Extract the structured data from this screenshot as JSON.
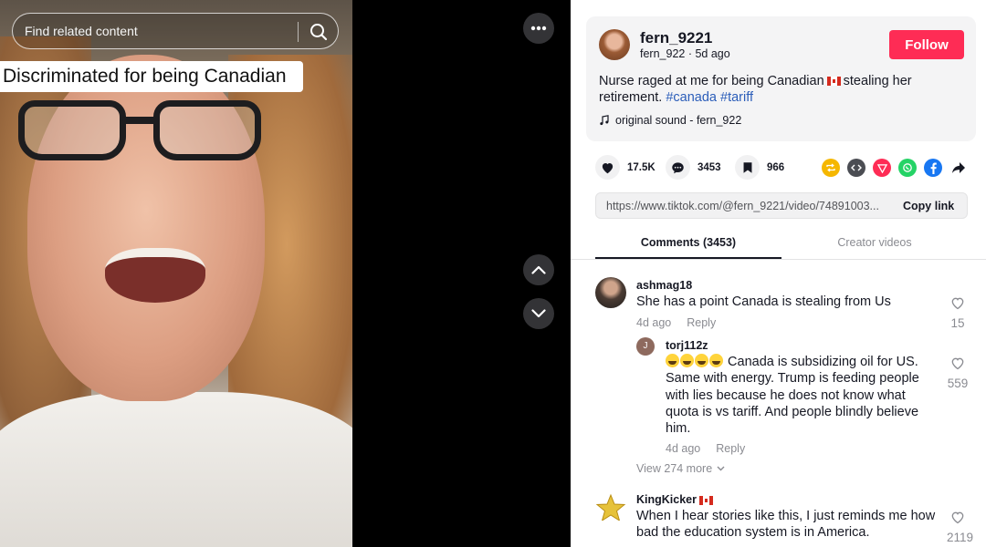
{
  "video": {
    "search_placeholder": "Find related content",
    "caption_overlay": "Discriminated for being Canadian"
  },
  "author": {
    "name": "fern_9221",
    "handle": "fern_922",
    "age": "5d ago",
    "follow_label": "Follow"
  },
  "description": {
    "text_before_flag": "Nurse raged at me for being Canadian",
    "text_after_flag": "stealing her retirement.",
    "hashtags": [
      "#canada",
      "#tariff"
    ]
  },
  "music": {
    "label": "original sound - fern_922"
  },
  "stats": {
    "likes": "17.5K",
    "comments": "3453",
    "saves": "966"
  },
  "share_icons": [
    "repost-icon",
    "embed-icon",
    "send-to-friends-icon",
    "whatsapp-icon",
    "facebook-icon",
    "share-arrow-icon"
  ],
  "colors": {
    "follow": "#fe2c55",
    "hashtag": "#2b5db9",
    "repost": "#f5b700",
    "embed": "#4b4d53",
    "send": "#fe2c55",
    "whatsapp": "#25d366",
    "facebook": "#1877f2"
  },
  "link": {
    "url": "https://www.tiktok.com/@fern_9221/video/74891003...",
    "copy_label": "Copy link"
  },
  "tabs": [
    {
      "label": "Comments (3453)"
    },
    {
      "label": "Creator videos"
    }
  ],
  "comments": [
    {
      "user": "ashmag18",
      "text": "She has a point Canada is stealing from Us",
      "age": "4d ago",
      "reply_label": "Reply",
      "likes": "15"
    },
    {
      "user": "torj112z",
      "avatar_letter": "J",
      "text_lines": [
        "Canada is subsidizing oil for US.",
        "Same with energy. Trump is feeding people",
        "with lies because he does not know what",
        "quota is vs tariff. And people blindly believe",
        "him."
      ],
      "age": "4d ago",
      "reply_label": "Reply",
      "likes": "559"
    },
    {
      "user": "KingKicker",
      "text_lines": [
        "When I hear stories like this, I just reminds me how",
        "bad the education system is in America."
      ],
      "likes": "2119"
    }
  ],
  "view_more": "View 274 more"
}
